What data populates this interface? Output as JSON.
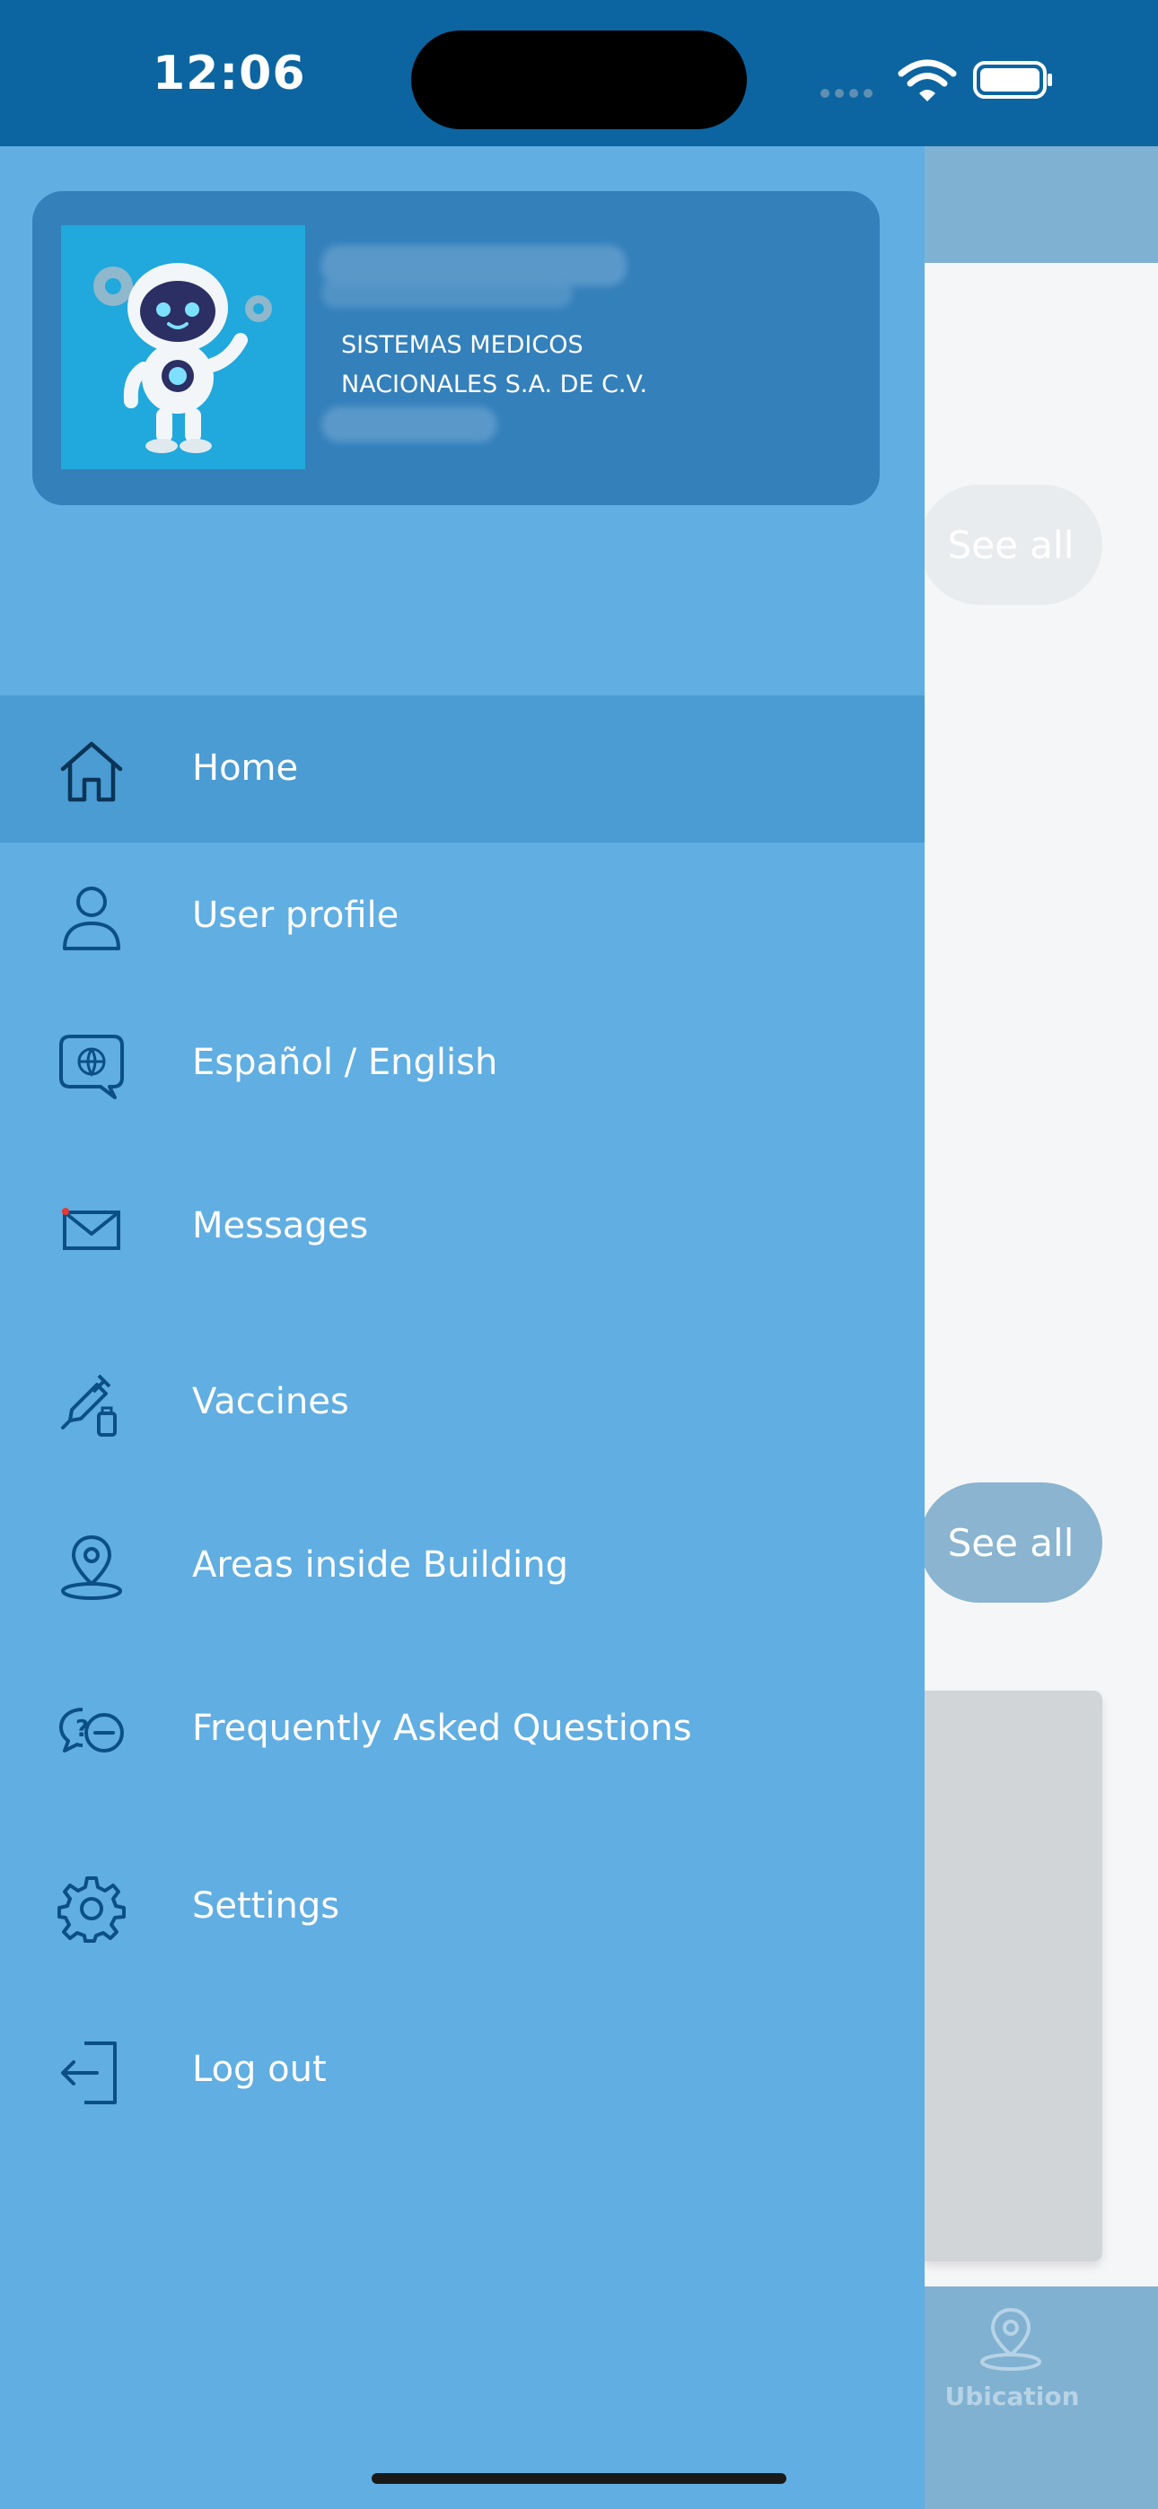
{
  "status_bar": {
    "time": "12:06"
  },
  "profile": {
    "company_line1": "SISTEMAS MEDICOS",
    "company_line2": "NACIONALES S.A. DE C.V.",
    "avatar_icon": "robot-icon"
  },
  "menu": {
    "items": [
      {
        "label": "Home",
        "icon": "home-icon",
        "active": true
      },
      {
        "label": "User profile",
        "icon": "user-icon"
      },
      {
        "label": "Español / English",
        "icon": "language-icon"
      },
      {
        "label": "Messages",
        "icon": "mail-icon"
      },
      {
        "label": "Vaccines",
        "icon": "syringe-icon"
      },
      {
        "label": "Areas inside Building",
        "icon": "location-pin-icon"
      },
      {
        "label": "Frequently Asked Questions",
        "icon": "faq-icon"
      },
      {
        "label": "Settings",
        "icon": "gear-icon"
      },
      {
        "label": "Log out",
        "icon": "logout-icon"
      }
    ]
  },
  "background": {
    "see_all_1": "See all",
    "see_all_2": "See all",
    "tab_label": "Ubication"
  },
  "colors": {
    "status_bar": "#0c65a0",
    "drawer": "#60aee2",
    "active_item": "#4a9cd3",
    "profile_card": "#3480bb",
    "icon_stroke": "#0b4f86"
  }
}
